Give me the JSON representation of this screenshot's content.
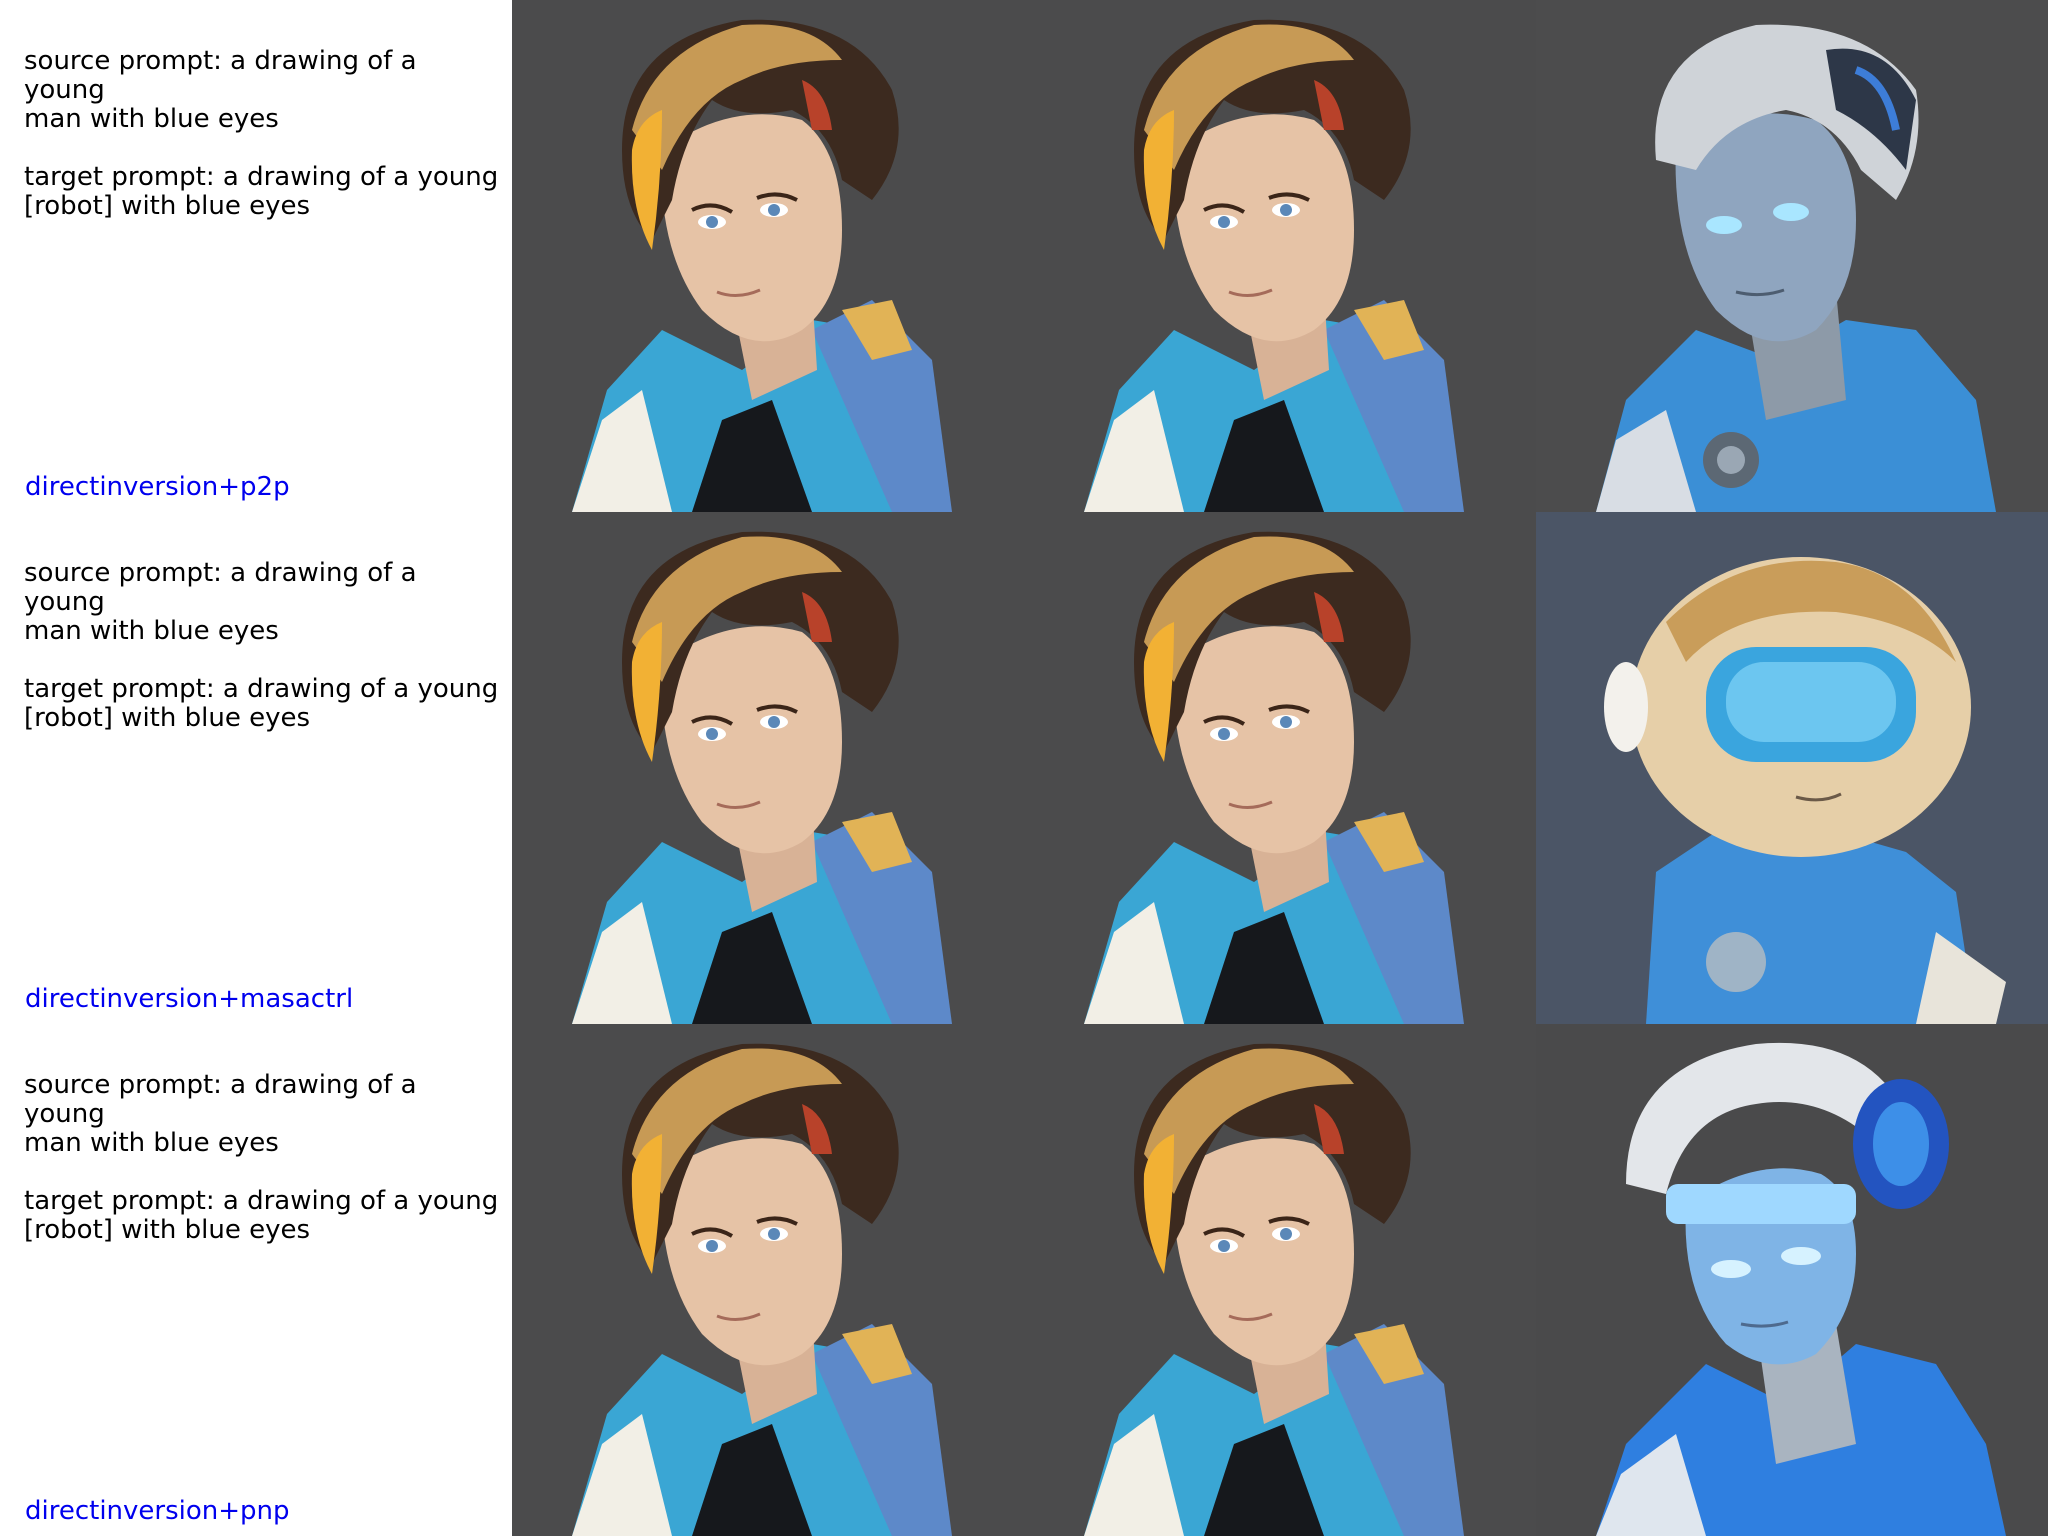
{
  "rows": [
    {
      "source_prompt": "source prompt: a drawing of a young\nman with blue eyes",
      "target_prompt": "target prompt: a drawing of a young\n[robot] with blue eyes",
      "method": "directinversion+p2p"
    },
    {
      "source_prompt": "source prompt: a drawing of a young\nman with blue eyes",
      "target_prompt": "target prompt: a drawing of a young\n[robot] with blue eyes",
      "method": "directinversion+masactrl"
    },
    {
      "source_prompt": "source prompt: a drawing of a young\nman with blue eyes",
      "target_prompt": "target prompt: a drawing of a young\n[robot] with blue eyes",
      "method": "directinversion+pnp"
    }
  ],
  "colors": {
    "method_label": "#0000ee",
    "prompt_text": "#000000",
    "image_background": "#4a4a4b"
  }
}
